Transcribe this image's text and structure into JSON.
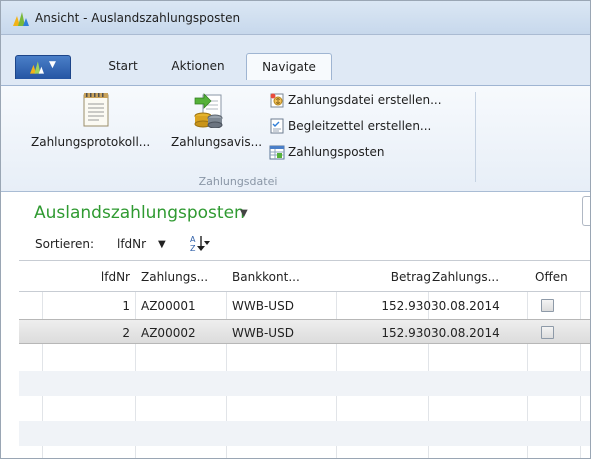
{
  "window": {
    "title": "Ansicht - Auslandszahlungsposten"
  },
  "ribbon": {
    "tabs": [
      "Start",
      "Aktionen",
      "Navigate"
    ],
    "active_tab": "Navigate",
    "group_label": "Zahlungsdatei",
    "large_buttons": [
      "Zahlungsprotokoll...",
      "Zahlungsavis..."
    ],
    "small_buttons": [
      "Zahlungsdatei erstellen...",
      "Begleitzettel erstellen...",
      "Zahlungsposten"
    ]
  },
  "page": {
    "title": "Auslandszahlungsposten",
    "sort_label": "Sortieren:",
    "sort_field": "lfdNr"
  },
  "grid": {
    "columns": [
      "lfdNr",
      "Zahlungs...",
      "Bankkont...",
      "Betrag",
      "Zahlungs...",
      "Offen"
    ],
    "rows": [
      {
        "lfdnr": "1",
        "zahlungs": "AZ00001",
        "bankkonto": "WWB-USD",
        "betrag": "152.930",
        "datum": "30.08.2014",
        "offen": false
      },
      {
        "lfdnr": "2",
        "zahlungs": "AZ00002",
        "bankkonto": "WWB-USD",
        "betrag": "152.930",
        "datum": "30.08.2014",
        "offen": false
      }
    ]
  },
  "colors": {
    "accent_title": "#2f9a31",
    "ribbon_bg": "#dfe9f5",
    "app_button": "#2555a3"
  },
  "icons": [
    "app-logo-icon",
    "dropdown-arrow-icon",
    "protocol-document-icon",
    "payment-advice-icon",
    "create-file-icon",
    "cover-note-icon",
    "payment-entries-icon",
    "sort-direction-icon"
  ]
}
